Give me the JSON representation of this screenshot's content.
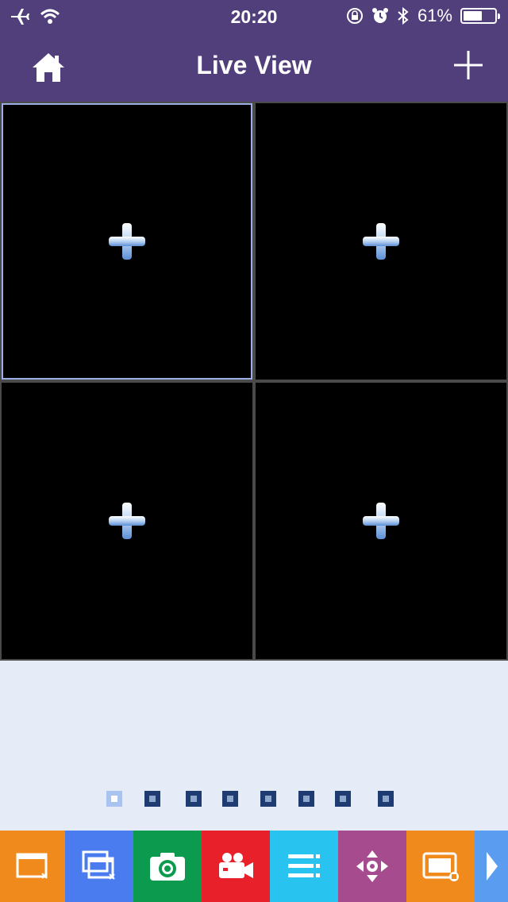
{
  "status_bar": {
    "time": "20:20",
    "battery_text": "61%",
    "battery_level": 0.61,
    "icons": [
      "airplane-icon",
      "wifi-icon",
      "rotation-lock-icon",
      "alarm-icon",
      "bluetooth-icon",
      "battery-icon"
    ]
  },
  "nav": {
    "title": "Live View",
    "left_icon": "home-icon",
    "right_icon": "plus-icon"
  },
  "grid": {
    "tiles": [
      {
        "icon": "add-camera-plus-icon",
        "selected": true
      },
      {
        "icon": "add-camera-plus-icon",
        "selected": false
      },
      {
        "icon": "add-camera-plus-icon",
        "selected": false
      },
      {
        "icon": "add-camera-plus-icon",
        "selected": false
      }
    ]
  },
  "pager": {
    "page_count": 8,
    "active_index": 0
  },
  "toolbar": {
    "items": [
      {
        "icon": "close-window-icon",
        "color": "#f08a1c"
      },
      {
        "icon": "close-all-windows-icon",
        "color": "#4a7cf0"
      },
      {
        "icon": "snapshot-camera-icon",
        "color": "#0b9a4e"
      },
      {
        "icon": "record-video-icon",
        "color": "#e8202a"
      },
      {
        "icon": "menu-list-icon",
        "color": "#28c3ef"
      },
      {
        "icon": "ptz-move-icon",
        "color": "#a64c8e"
      },
      {
        "icon": "window-layout-icon",
        "color": "#f08a1c"
      },
      {
        "icon": "next-arrow-icon",
        "color": "#5a9cf0"
      }
    ]
  },
  "colors": {
    "header": "#513f7c",
    "grid_line": "#4a4a4a",
    "tile_bg": "#000000",
    "selected_border": "#9aafe6",
    "panel_bg": "#e6ecf7"
  }
}
